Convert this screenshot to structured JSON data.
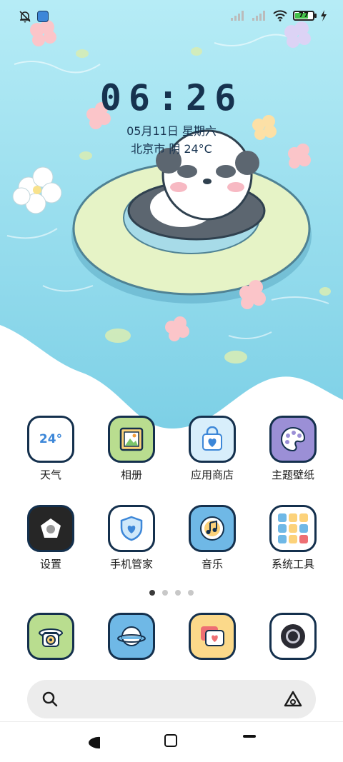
{
  "status_bar": {
    "icons_left": [
      "mute-bell-icon",
      "app-notification-icon"
    ],
    "icons_right": [
      "signal-icon",
      "signal-icon",
      "wifi-icon",
      "battery-icon",
      "charging-icon"
    ],
    "battery_level": "77",
    "battery_fraction": 0.77
  },
  "lockclock": {
    "time": "06:26",
    "date": "05月11日 星期六",
    "weather": "北京市 阴 24°C"
  },
  "apps": [
    {
      "label": "天气",
      "icon": "weather-icon",
      "badge": "24°",
      "bg": "#ffffff"
    },
    {
      "label": "相册",
      "icon": "gallery-icon",
      "bg": "#b9dd8f"
    },
    {
      "label": "应用商店",
      "icon": "app-store-icon",
      "bg": "#d8eefb"
    },
    {
      "label": "主题壁纸",
      "icon": "theme-icon",
      "bg": "#9b8fd6"
    },
    {
      "label": "设置",
      "icon": "settings-icon",
      "bg": "#262626"
    },
    {
      "label": "手机管家",
      "icon": "security-icon",
      "bg": "#ffffff"
    },
    {
      "label": "音乐",
      "icon": "music-icon",
      "bg": "#6fb8e6"
    },
    {
      "label": "系统工具",
      "icon": "tools-folder-icon",
      "bg": "#ffffff"
    }
  ],
  "page_indicator": {
    "count": 4,
    "active": 0
  },
  "dock": [
    {
      "name": "phone",
      "icon": "phone-icon",
      "bg": "#b9dd8f"
    },
    {
      "name": "browser",
      "icon": "browser-icon",
      "bg": "#6fb8e6"
    },
    {
      "name": "messages",
      "icon": "messages-icon",
      "bg": "#fbd98a"
    },
    {
      "name": "camera",
      "icon": "camera-icon",
      "bg": "#ffffff"
    }
  ],
  "search": {
    "placeholder": ""
  },
  "colors": {
    "outline": "#14304d",
    "water": "#7fd3e8",
    "text": "#16324f"
  }
}
